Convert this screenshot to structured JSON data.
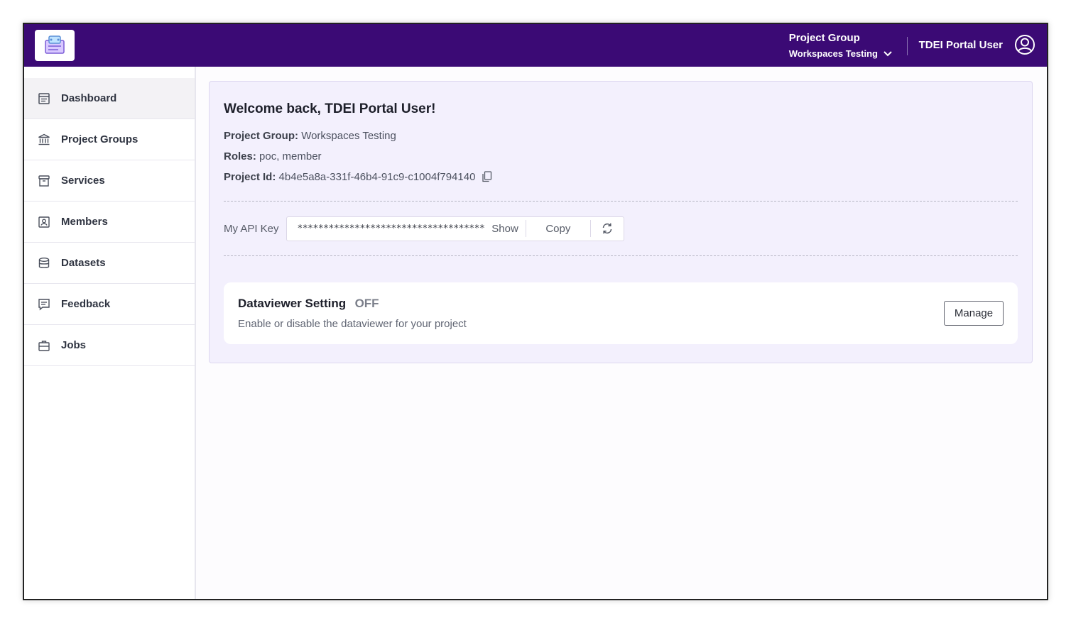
{
  "header": {
    "project_group_label": "Project Group",
    "project_group_value": "Workspaces Testing",
    "user_name": "TDEI Portal User",
    "bg_color": "#3b0a75"
  },
  "sidebar": {
    "items": [
      {
        "label": "Dashboard",
        "icon": "dashboard-icon",
        "active": true
      },
      {
        "label": "Project Groups",
        "icon": "bank-icon"
      },
      {
        "label": "Services",
        "icon": "archive-box-icon"
      },
      {
        "label": "Members",
        "icon": "member-badge-icon"
      },
      {
        "label": "Datasets",
        "icon": "database-icon"
      },
      {
        "label": "Feedback",
        "icon": "feedback-icon"
      },
      {
        "label": "Jobs",
        "icon": "briefcase-icon"
      }
    ]
  },
  "welcome": {
    "title": "Welcome back, TDEI Portal User!",
    "project_group_label": "Project Group:",
    "project_group_value": "Workspaces Testing",
    "roles_label": "Roles:",
    "roles_value": "poc, member",
    "project_id_label": "Project Id:",
    "project_id_value": "4b4e5a8a-331f-46b4-91c9-c1004f794140"
  },
  "api": {
    "label": "My API Key",
    "masked_key": "************************************",
    "show_label": "Show",
    "copy_label": "Copy"
  },
  "dataviewer": {
    "title": "Dataviewer Setting",
    "status": "OFF",
    "description": "Enable or disable the dataviewer for your project",
    "manage_label": "Manage"
  }
}
